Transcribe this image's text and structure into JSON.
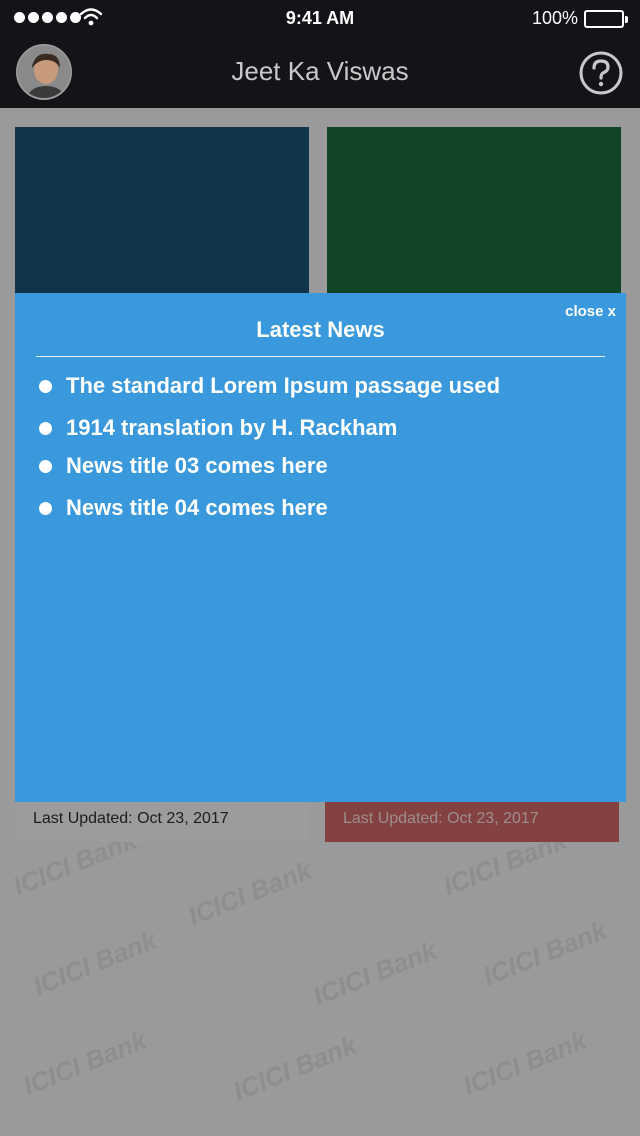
{
  "status_bar": {
    "time": "9:41 AM",
    "battery_percent": "100%",
    "signal_icon": "signal-dots-icon",
    "wifi_icon": "wifi-icon",
    "battery_icon": "battery-icon"
  },
  "header": {
    "title": "Jeet Ka Viswas",
    "avatar_icon": "user-avatar",
    "help_icon": "help-circle-icon"
  },
  "tiles": [
    {
      "color": "#1b4f74"
    },
    {
      "color": "#1a6b3b"
    }
  ],
  "tile_footers": [
    {
      "text": "Last Updated: Oct 23, 2017"
    },
    {
      "text": "Last Updated: Oct 23, 2017"
    }
  ],
  "watermark": {
    "text": "ICICI Bank"
  },
  "modal": {
    "title": "Latest News",
    "close_label": "close x",
    "background": "#3a99dc",
    "items": [
      {
        "title": "The standard Lorem Ipsum passage used"
      },
      {
        "title": "1914 translation by H. Rackham"
      },
      {
        "title": "News title 03 comes here"
      },
      {
        "title": "News title 04 comes here"
      }
    ]
  }
}
